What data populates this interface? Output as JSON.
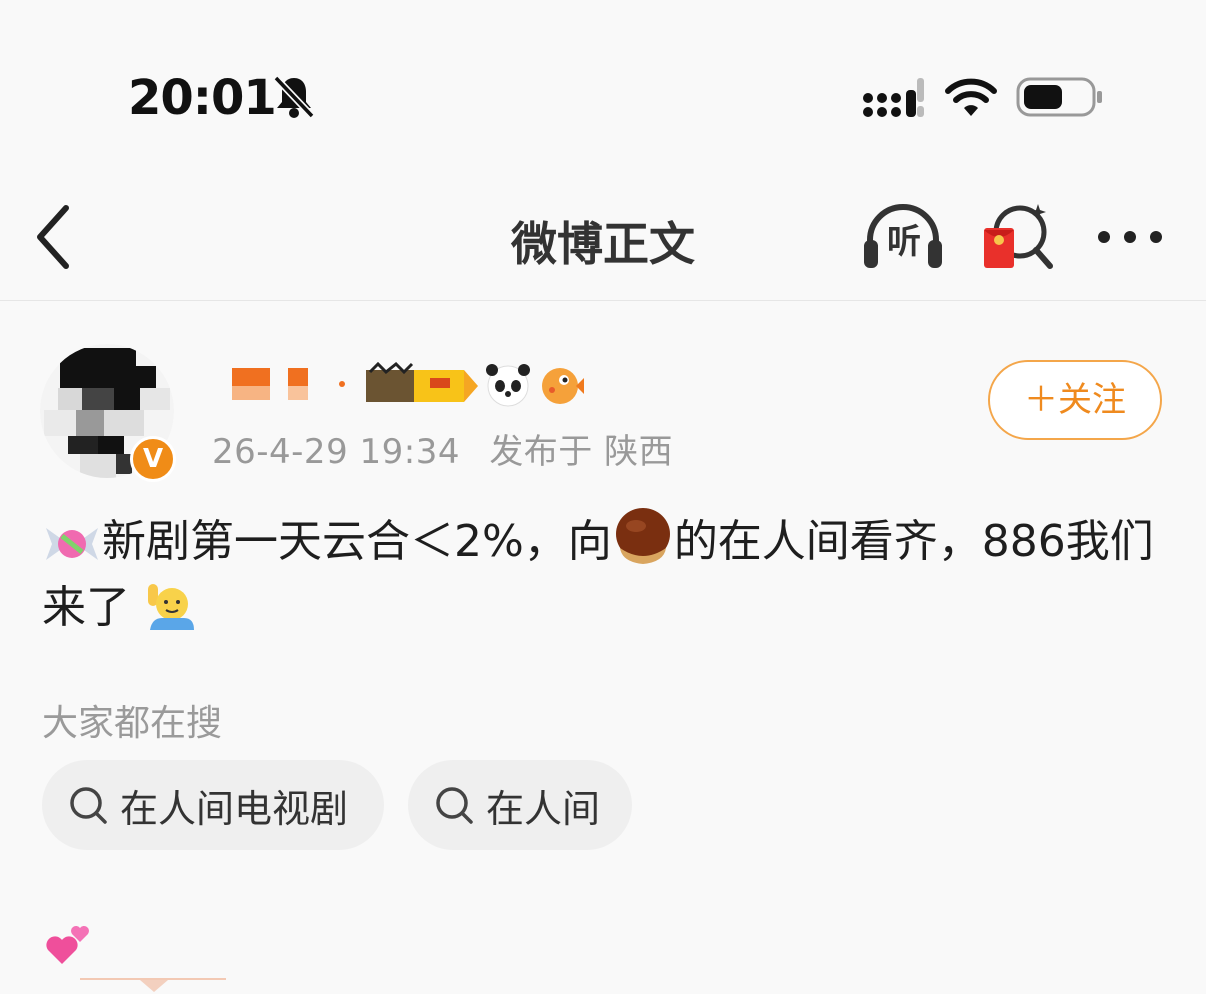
{
  "status_bar": {
    "time": "20:01",
    "icons": [
      "bell-slash-icon",
      "cellular-signal-icon",
      "wifi-icon",
      "battery-icon"
    ]
  },
  "nav": {
    "title": "微博正文",
    "listen_label": "听",
    "icons": [
      "back-chevron-icon",
      "headphones-icon",
      "red-packet-search-icon",
      "more-dots-icon"
    ]
  },
  "post": {
    "timestamp": "26-4-29 19:34",
    "published_at_label": "发布于 陕西",
    "verified_badge": "V",
    "follow_label": "＋关注",
    "text_part1": "新剧第一天云合＜2%，向",
    "text_part2": "的在人间看齐，886我们来了",
    "emojis": [
      "candy-emoji",
      "chestnut-emoji",
      "raising-hand-emoji",
      "panda-emoji",
      "pufferfish-emoji",
      "two-hearts-emoji"
    ]
  },
  "trending": {
    "title": "大家都在搜",
    "chips": [
      {
        "label": "在人间电视剧"
      },
      {
        "label": "在人间"
      }
    ]
  },
  "colors": {
    "accent_orange": "#ef8a1e",
    "follow_border": "#f4a64a",
    "muted_text": "#999999",
    "chip_bg": "#efefef",
    "page_bg": "#f9f9f9"
  }
}
